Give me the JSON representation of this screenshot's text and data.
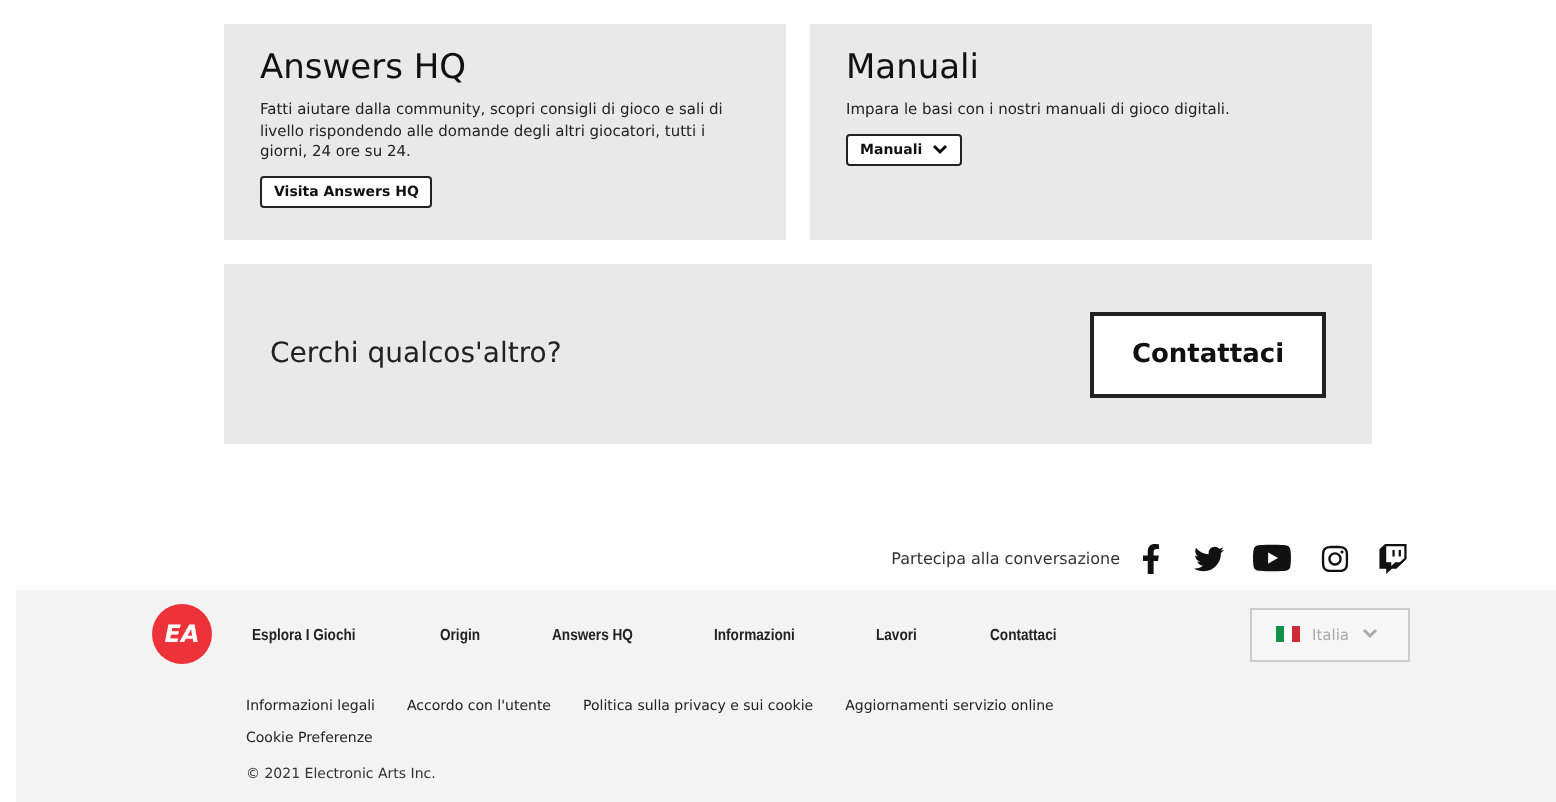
{
  "cards": [
    {
      "title": "Answers HQ",
      "text": "Fatti aiutare dalla community, scopri consigli di gioco e sali di livello rispondendo alle domande degli altri giocatori, tutti i giorni, 24 ore su 24.",
      "button": {
        "label": "Visita Answers HQ",
        "kind": "link"
      }
    },
    {
      "title": "Manuali",
      "text": "Impara le basi con i nostri manuali di gioco digitali.",
      "button": {
        "label": "Manuali",
        "kind": "dropdown"
      }
    }
  ],
  "contact": {
    "text": "Cerchi qualcos'altro?",
    "button": "Contattaci"
  },
  "social": {
    "label": "Partecipa alla conversazione"
  },
  "footer": {
    "logo": "EA",
    "nav": [
      "Esplora I Giochi",
      "Origin",
      "Answers HQ",
      "Informazioni",
      "Lavori",
      "Contattaci"
    ],
    "region": "Italia",
    "links": [
      "Informazioni legali",
      "Accordo con l'utente",
      "Politica sulla privacy e sui cookie",
      "Aggiornamenti servizio online",
      "Cookie Preferenze"
    ],
    "copyright": "© 2021 Electronic Arts Inc."
  }
}
